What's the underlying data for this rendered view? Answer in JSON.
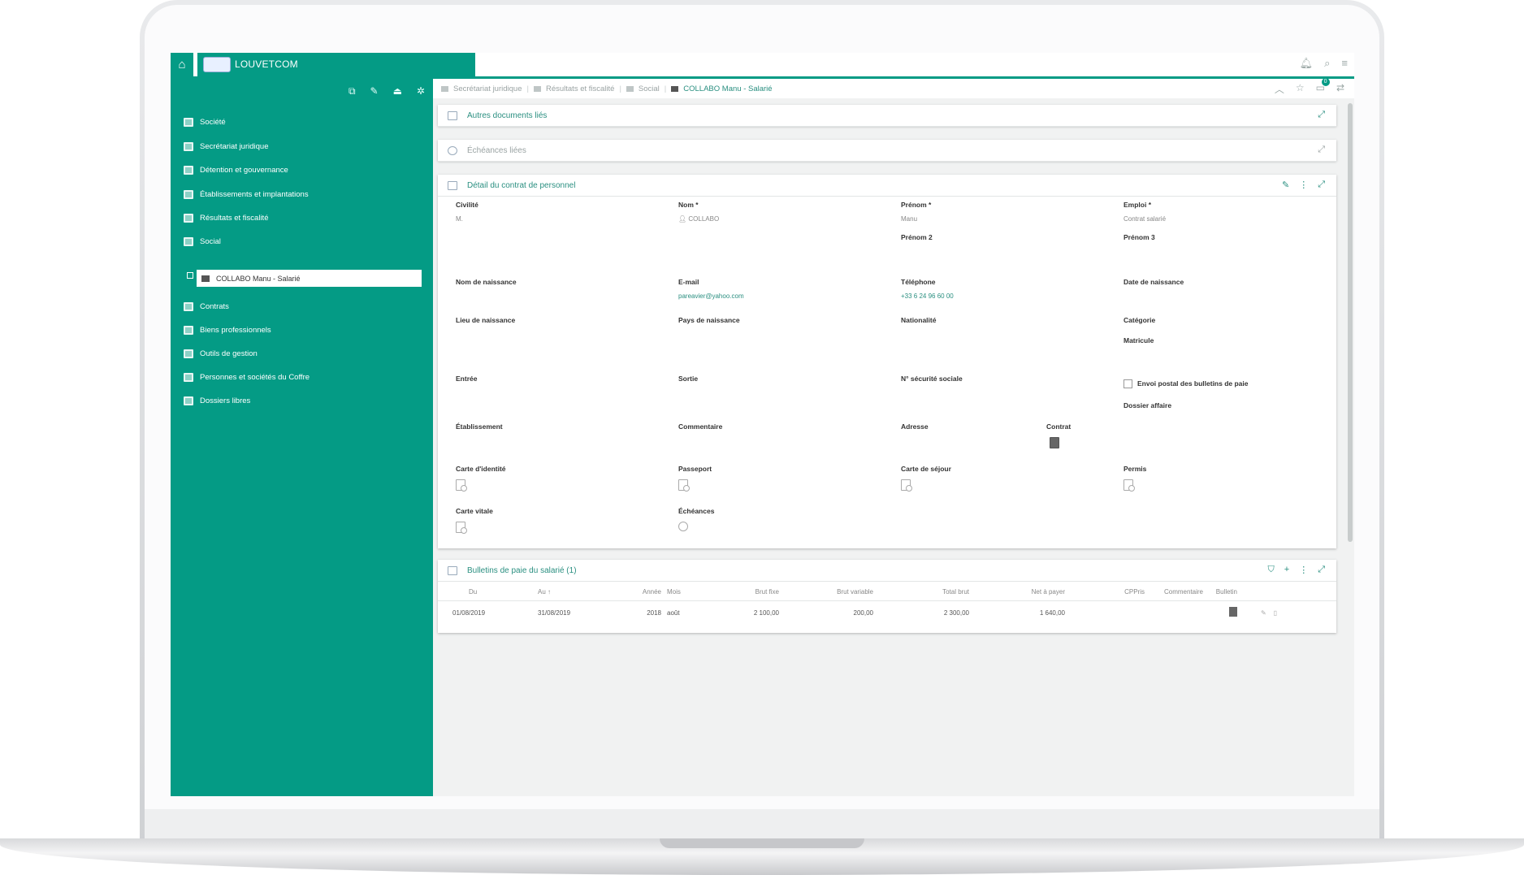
{
  "app": {
    "brand_name": "LOUVETCOM",
    "accent_color": "#049b85"
  },
  "sidebar": {
    "tools": [
      "add-page-icon",
      "user-edit-icon",
      "upload-icon",
      "settings-icon"
    ],
    "items": [
      {
        "label": "Société"
      },
      {
        "label": "Secrétariat juridique"
      },
      {
        "label": "Détention et gouvernance"
      },
      {
        "label": "Établissements et implantations"
      },
      {
        "label": "Résultats et fiscalité"
      },
      {
        "label": "Social"
      },
      {
        "label": "Contrats"
      },
      {
        "label": "Biens professionnels"
      },
      {
        "label": "Outils de gestion"
      },
      {
        "label": "Personnes et sociétés du Coffre"
      },
      {
        "label": "Dossiers libres"
      }
    ],
    "selected_sub": "COLLABO Manu - Salarié"
  },
  "breadcrumb": {
    "items": [
      "Secrétariat juridique",
      "Résultats et fiscalité",
      "Social"
    ],
    "current": "COLLABO Manu - Salarié",
    "notification_count": "0"
  },
  "panels": {
    "docs": {
      "title": "Autres documents liés"
    },
    "echeances": {
      "title": "Échéances liées"
    },
    "contrat": {
      "title": "Détail du contrat de personnel",
      "civilite": {
        "label": "Civilité",
        "value": "M."
      },
      "nom": {
        "label": "Nom *",
        "value": "COLLABO"
      },
      "prenom": {
        "label": "Prénom *",
        "value": "Manu"
      },
      "emploi": {
        "label": "Emploi *",
        "value": "Contrat salarié"
      },
      "prenom2": {
        "label": "Prénom 2"
      },
      "prenom3": {
        "label": "Prénom 3"
      },
      "nom_naissance": {
        "label": "Nom de naissance"
      },
      "email": {
        "label": "E-mail",
        "value": "pareavier@yahoo.com"
      },
      "telephone": {
        "label": "Téléphone",
        "value": "+33 6 24 96 60 00"
      },
      "date_naissance": {
        "label": "Date de naissance"
      },
      "lieu_naissance": {
        "label": "Lieu de naissance"
      },
      "pays_naissance": {
        "label": "Pays de naissance"
      },
      "nationalite": {
        "label": "Nationalité"
      },
      "categorie": {
        "label": "Catégorie"
      },
      "matricule": {
        "label": "Matricule"
      },
      "entree": {
        "label": "Entrée"
      },
      "sortie": {
        "label": "Sortie"
      },
      "secu": {
        "label": "N° sécurité sociale"
      },
      "envoi_postal": {
        "label": "Envoi postal des bulletins de paie"
      },
      "dossier_affaire": {
        "label": "Dossier affaire"
      },
      "etablissement": {
        "label": "Établissement"
      },
      "commentaire": {
        "label": "Commentaire"
      },
      "adresse": {
        "label": "Adresse"
      },
      "contrat": {
        "label": "Contrat"
      },
      "carte_identite": {
        "label": "Carte d'identité"
      },
      "passeport": {
        "label": "Passeport"
      },
      "carte_sejour": {
        "label": "Carte de séjour"
      },
      "permis": {
        "label": "Permis"
      },
      "carte_vitale": {
        "label": "Carte vitale"
      },
      "echeances_field": {
        "label": "Échéances"
      }
    },
    "bulletins": {
      "title": "Bulletins de paie du salarié (1)",
      "columns": [
        "Du",
        "Au ↑",
        "Année",
        "Mois",
        "Brut fixe",
        "Brut variable",
        "Total brut",
        "Net à payer",
        "CPPris",
        "Commentaire",
        "Bulletin"
      ],
      "rows": [
        {
          "du": "01/08/2019",
          "au": "31/08/2019",
          "annee": "2018",
          "mois": "août",
          "brut_fixe": "2 100,00",
          "brut_variable": "200,00",
          "total_brut": "2 300,00",
          "net": "1 640,00"
        }
      ]
    }
  }
}
